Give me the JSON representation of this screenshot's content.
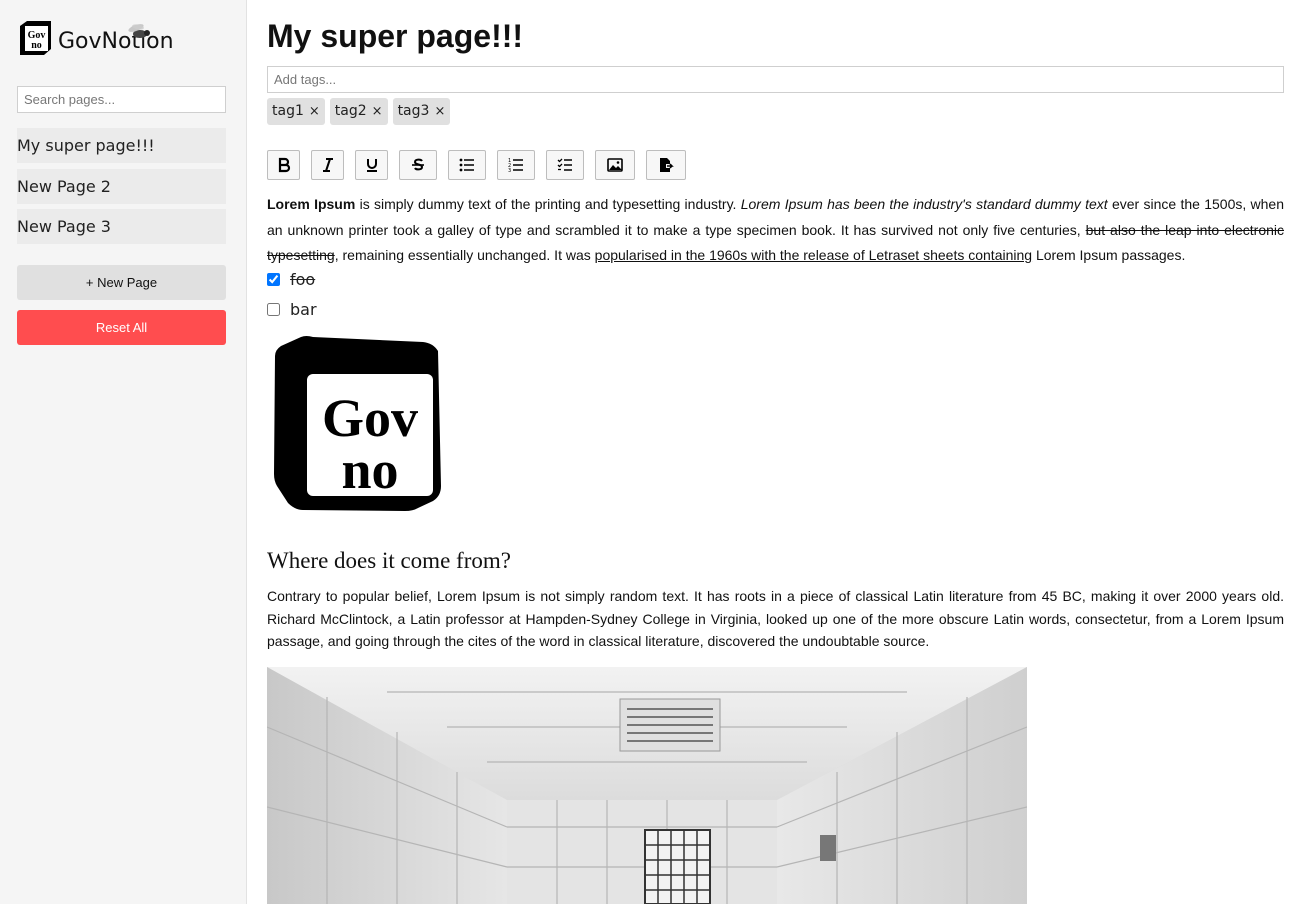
{
  "brand": {
    "name": "GovNotion",
    "logo_text_top": "Gov",
    "logo_text_bottom": "no"
  },
  "sidebar": {
    "search_placeholder": "Search pages...",
    "pages": [
      {
        "label": "My super page!!!"
      },
      {
        "label": "New Page 2"
      },
      {
        "label": "New Page 3"
      }
    ],
    "new_page_label": "+ New Page",
    "reset_label": "Reset All",
    "reset_color": "#ff4d4f"
  },
  "page": {
    "title": "My super page!!!",
    "tags_placeholder": "Add tags...",
    "tags": [
      {
        "label": "tag1"
      },
      {
        "label": "tag2"
      },
      {
        "label": "tag3"
      }
    ],
    "tag_remove": "×",
    "toolbar": [
      "bold-icon",
      "italic-icon",
      "underline-icon",
      "strikethrough-icon",
      "bullet-list-icon",
      "numbered-list-icon",
      "checklist-icon",
      "image-icon",
      "export-icon"
    ],
    "para1": {
      "bold": "Lorem Ipsum",
      "t1": " is simply dummy text of the printing and typesetting industry. ",
      "italic": "Lorem Ipsum has been the industry's standard dummy text",
      "t2": " ever since the 1500s, when an unknown printer took a galley of type and scrambled it to make a type specimen book. It has survived not only five centuries, ",
      "strike": "but also the leap into electronic typesetting",
      "t3": ", remaining essentially unchanged. It was ",
      "underline": "popularised in the 1960s with the release of Letraset sheets containing",
      "t4": " Lorem Ipsum passages."
    },
    "checklist": [
      {
        "label": "foo",
        "checked": true
      },
      {
        "label": "bar",
        "checked": false
      }
    ],
    "heading": "Where does it come from?",
    "para2": "Contrary to popular belief, Lorem Ipsum is not simply random text. It has roots in a piece of classical Latin literature from 45 BC, making it over 2000 years old. Richard McClintock, a Latin professor at Hampden-Sydney College in Virginia, looked up one of the more obscure Latin words, consectetur, from a Lorem Ipsum passage, and going through the cites of the word in classical literature, discovered the undoubtable source."
  }
}
